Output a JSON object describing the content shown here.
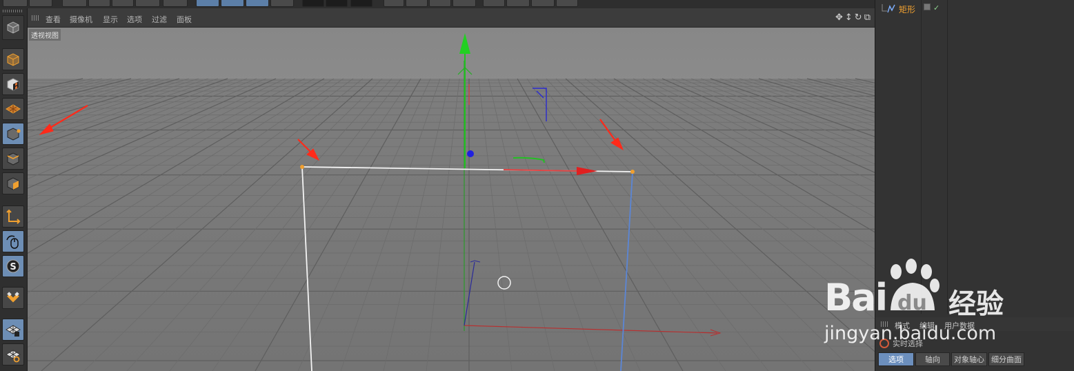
{
  "viewport": {
    "menu": [
      "查看",
      "摄像机",
      "显示",
      "选项",
      "过滤",
      "面板"
    ],
    "view_label": "透视视图",
    "nav_icons": [
      "move-view-icon",
      "zoom-view-icon",
      "rotate-view-icon",
      "maximize-view-icon"
    ]
  },
  "left_tools": [
    {
      "name": "make-editable-icon"
    },
    {
      "name": "texture-mode-icon"
    },
    {
      "name": "texture-axis-icon"
    },
    {
      "name": "points-mode-icon"
    },
    {
      "name": "edges-mode-icon"
    },
    {
      "name": "polygons-mode-icon"
    },
    {
      "name": "axis-mode-icon"
    },
    {
      "name": "tweak-mode-icon"
    },
    {
      "name": "solo-icon"
    },
    {
      "name": "snap-icon"
    },
    {
      "name": "workplane-lock-icon"
    },
    {
      "name": "workplane-icon"
    }
  ],
  "object_manager": {
    "object_name": "矩形",
    "object_icon": "spline-icon"
  },
  "attributes": {
    "tabs": [
      "模式",
      "编辑",
      "用户数据"
    ],
    "live_selection": "实时选择",
    "bottom_tabs": [
      "选项",
      "轴向",
      "对象轴心",
      "细分曲面"
    ],
    "active_tab": "选项"
  },
  "watermark": {
    "logo_text": "Bai",
    "logo_text2": "du",
    "brand": "经验",
    "url": "jingyan.baidu.com"
  },
  "colors": {
    "viewport_bg": "#8a8a8a",
    "accent_blue": "#6c8fbd",
    "object_orange": "#f0a030",
    "arrow_red": "#ff2a1a"
  }
}
